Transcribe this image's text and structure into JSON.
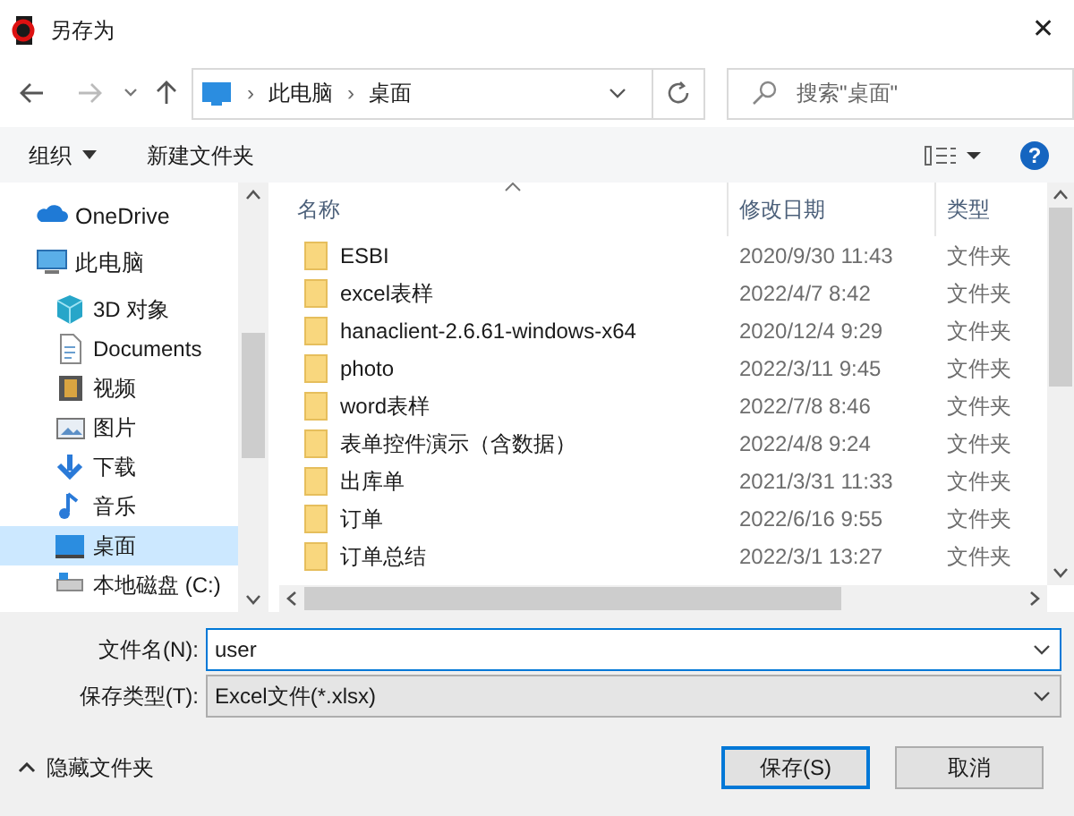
{
  "window": {
    "title": "另存为",
    "close": "✕"
  },
  "address": {
    "segments": [
      "此电脑",
      "桌面"
    ],
    "separator": "›"
  },
  "search": {
    "placeholder": "搜索\"桌面\""
  },
  "toolbar": {
    "organize": "组织",
    "new_folder": "新建文件夹",
    "help": "?"
  },
  "sidebar": {
    "items": [
      {
        "label": "OneDrive",
        "kind": "cloud",
        "selected": false
      },
      {
        "label": "此电脑",
        "kind": "pc",
        "selected": false,
        "children": [
          {
            "label": "3D 对象",
            "kind": "cube",
            "selected": false
          },
          {
            "label": "Documents",
            "kind": "doc",
            "selected": false
          },
          {
            "label": "视频",
            "kind": "video",
            "selected": false
          },
          {
            "label": "图片",
            "kind": "picture",
            "selected": false
          },
          {
            "label": "下载",
            "kind": "download",
            "selected": false
          },
          {
            "label": "音乐",
            "kind": "music",
            "selected": false
          },
          {
            "label": "桌面",
            "kind": "desktop",
            "selected": true
          },
          {
            "label": "本地磁盘 (C:)",
            "kind": "disk",
            "selected": false
          }
        ]
      }
    ]
  },
  "table": {
    "columns": [
      "名称",
      "修改日期",
      "类型"
    ],
    "rows": [
      {
        "name": "ESBI",
        "modified": "2020/9/30 11:43",
        "type": "文件夹"
      },
      {
        "name": "excel表样",
        "modified": "2022/4/7 8:42",
        "type": "文件夹"
      },
      {
        "name": "hanaclient-2.6.61-windows-x64",
        "modified": "2020/12/4 9:29",
        "type": "文件夹"
      },
      {
        "name": "photo",
        "modified": "2022/3/11 9:45",
        "type": "文件夹"
      },
      {
        "name": "word表样",
        "modified": "2022/7/8 8:46",
        "type": "文件夹"
      },
      {
        "name": "表单控件演示（含数据）",
        "modified": "2022/4/8 9:24",
        "type": "文件夹"
      },
      {
        "name": "出库单",
        "modified": "2021/3/31 11:33",
        "type": "文件夹"
      },
      {
        "name": "订单",
        "modified": "2022/6/16 9:55",
        "type": "文件夹"
      },
      {
        "name": "订单总结",
        "modified": "2022/3/1 13:27",
        "type": "文件夹"
      }
    ]
  },
  "form": {
    "filename_label": "文件名(N):",
    "filename": "user",
    "type_label": "保存类型(T):",
    "type_value": "Excel文件(*.xlsx)"
  },
  "footer": {
    "hide_folders": "隐藏文件夹",
    "save": "保存(S)",
    "cancel": "取消"
  }
}
